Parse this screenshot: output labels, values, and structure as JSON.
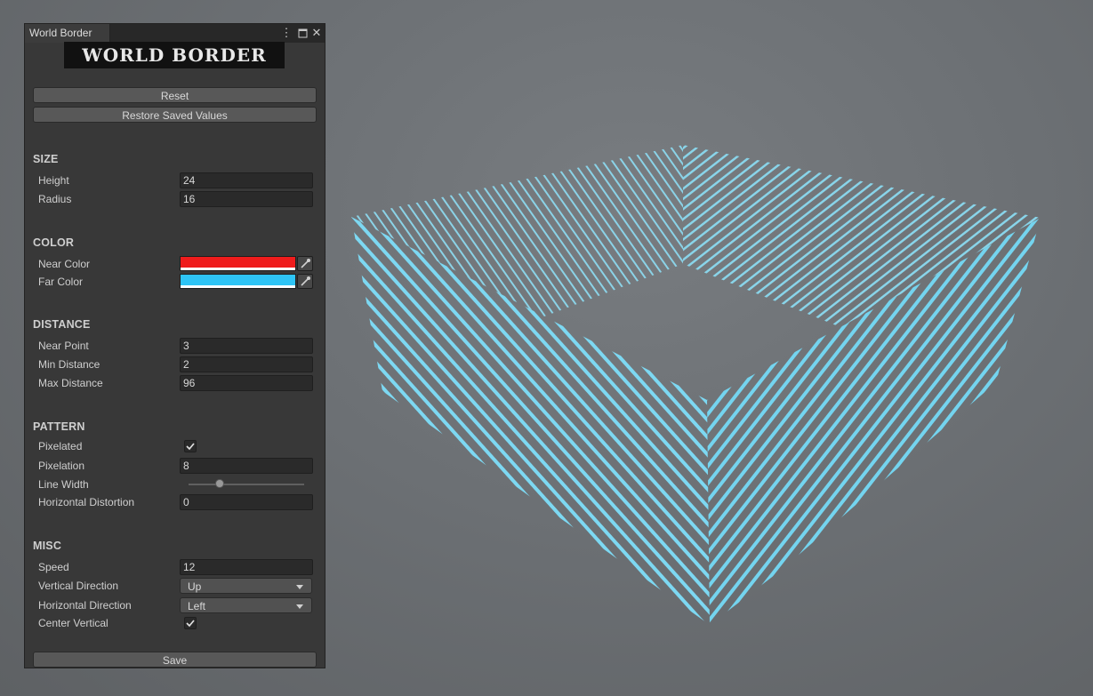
{
  "window": {
    "tab_title": "World Border",
    "logo_text": "WORLD BORDER",
    "menu_icon": "kebab-menu-icon",
    "maximize_icon": "maximize-icon",
    "close_icon": "close-icon"
  },
  "actions": {
    "reset_label": "Reset",
    "restore_label": "Restore Saved Values",
    "save_label": "Save"
  },
  "size": {
    "header": "SIZE",
    "height_label": "Height",
    "height_value": "24",
    "radius_label": "Radius",
    "radius_value": "16"
  },
  "color": {
    "header": "COLOR",
    "near_label": "Near Color",
    "near_value": "#ef1c1c",
    "far_label": "Far Color",
    "far_value": "#2ec4f5",
    "picker_icon": "eyedropper-icon"
  },
  "distance": {
    "header": "DISTANCE",
    "near_point_label": "Near Point",
    "near_point_value": "3",
    "min_label": "Min Distance",
    "min_value": "2",
    "max_label": "Max Distance",
    "max_value": "96"
  },
  "pattern": {
    "header": "PATTERN",
    "pixelated_label": "Pixelated",
    "pixelated_checked": true,
    "pixelation_label": "Pixelation",
    "pixelation_value": "8",
    "line_width_label": "Line Width",
    "line_width_fraction": 0.27,
    "hdist_label": "Horizontal Distortion",
    "hdist_value": "0"
  },
  "misc": {
    "header": "MISC",
    "speed_label": "Speed",
    "speed_value": "12",
    "vdir_label": "Vertical Direction",
    "vdir_value": "Up",
    "hdir_label": "Horizontal Direction",
    "hdir_value": "Left",
    "center_label": "Center Vertical",
    "center_checked": true
  },
  "scene": {
    "stripe_color": "#6fd4f0"
  }
}
